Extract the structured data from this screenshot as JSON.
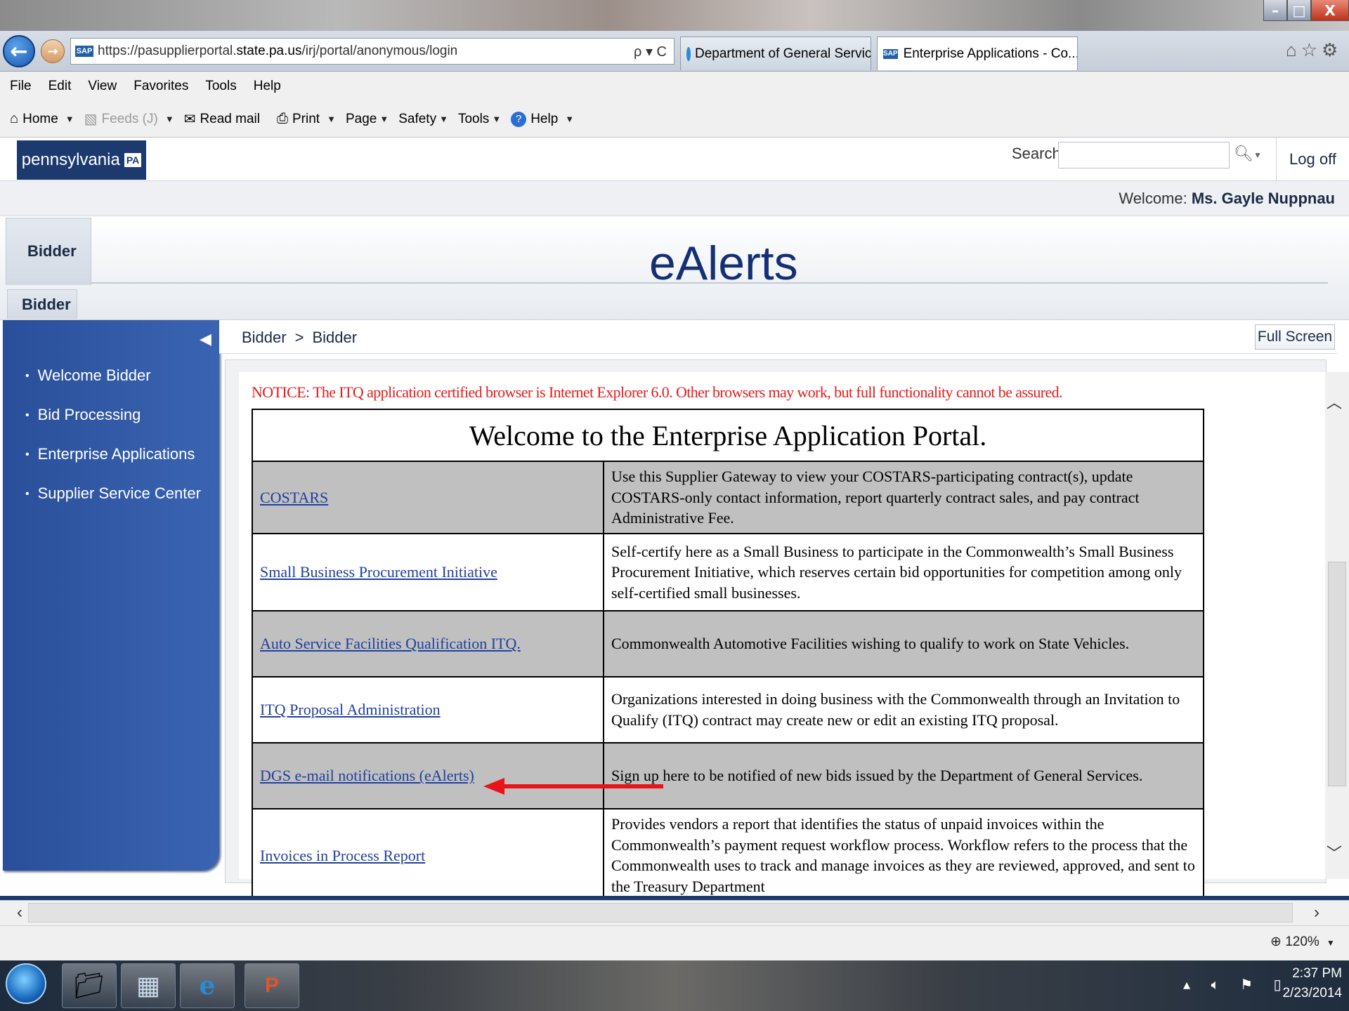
{
  "browser": {
    "url_prefix": "https://pasupplierportal.",
    "url_domain": "state.pa.us",
    "url_path": "/irj/portal/anonymous/login",
    "address_tools": "ρ ▾ C",
    "tabs": [
      {
        "label": "Department of General Services"
      },
      {
        "label": "Enterprise Applications - Co..."
      }
    ],
    "tab_close": "×",
    "menu": [
      "File",
      "Edit",
      "View",
      "Favorites",
      "Tools",
      "Help"
    ],
    "commands": {
      "home": "Home",
      "feeds": "Feeds (J)",
      "read_mail": "Read mail",
      "print": "Print",
      "page": "Page",
      "safety": "Safety",
      "tools": "Tools",
      "help": "Help"
    },
    "window_buttons": {
      "minimize": "–",
      "maximize": "□",
      "close": "X"
    },
    "zoom": "120%"
  },
  "portal": {
    "logo_text": "pennsylvania",
    "logo_badge": "PA",
    "search_label": "Search:",
    "search_value": "",
    "logoff": "Log off",
    "welcome_prefix": "Welcome: ",
    "welcome_name": "Ms. Gayle Nuppnau",
    "top_tab": "Bidder",
    "sub_tab": "Bidder",
    "overlay_title": "eAlerts",
    "nav_items": [
      "Welcome Bidder",
      "Bid Processing",
      "Enterprise Applications",
      "Supplier Service Center"
    ],
    "breadcrumb": [
      "Bidder",
      "Bidder"
    ],
    "breadcrumb_sep": ">",
    "full_screen": "Full Screen"
  },
  "content": {
    "notice": "NOTICE: The ITQ application certified browser is Internet Explorer 6.0. Other browsers may work, but full functionality cannot be assured.",
    "heading": "Welcome to the Enterprise Application Portal.",
    "applications": [
      {
        "name": "COSTARS",
        "description": "Use this Supplier Gateway to view your COSTARS-participating contract(s), update COSTARS-only contact information, report quarterly contract sales, and pay contract Administrative Fee."
      },
      {
        "name": "Small Business Procurement Initiative",
        "description": "Self-certify here as a Small Business to participate in the Commonwealth’s Small Business Procurement Initiative, which reserves certain bid opportunities for competition among only self-certified small businesses."
      },
      {
        "name": "Auto Service Facilities Qualification ITQ.",
        "description": "Commonwealth Automotive Facilities wishing to qualify to work on State Vehicles."
      },
      {
        "name": "ITQ Proposal Administration",
        "description": "Organizations interested in doing business with the Commonwealth through an Invitation to Qualify (ITQ) contract may create new or edit an existing ITQ proposal."
      },
      {
        "name": "DGS e-mail notifications (eAlerts)",
        "description": "Sign up here to be notified of new bids issued by the Department of General Services."
      },
      {
        "name": "Invoices in Process Report",
        "description": "Provides vendors a report that identifies the status of unpaid invoices within the Commonwealth’s payment request workflow process. Workflow refers to the process that the Commonwealth uses to track and manage invoices as they are reviewed, approved, and sent to the Treasury Department"
      }
    ],
    "annotation_arrow_color": "#e8141a"
  },
  "taskbar": {
    "time": "2:37 PM",
    "date": "2/23/2014"
  }
}
